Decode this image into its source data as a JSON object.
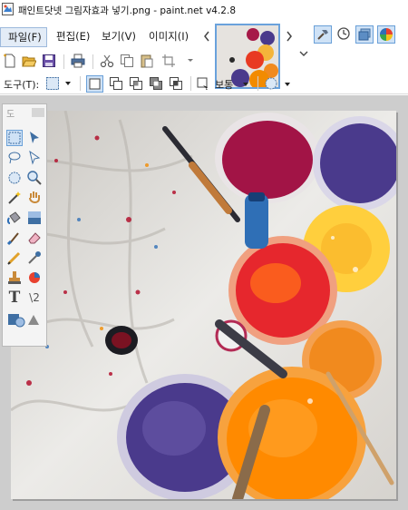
{
  "window": {
    "title": "패인트닷넷 그림자효과 넣기.png - paint.net v4.2.8"
  },
  "menu": {
    "items": [
      {
        "id": "file",
        "label": "파일(F)"
      },
      {
        "id": "edit",
        "label": "편집(E)"
      },
      {
        "id": "view",
        "label": "보기(V)"
      },
      {
        "id": "image",
        "label": "이미지(I)"
      }
    ]
  },
  "toolbar2": {
    "tool_label": "도구(T):",
    "sampling_label": "보통"
  },
  "tools_palette": {
    "title": "도"
  },
  "icons": {
    "app": "paintnet-app-icon",
    "nav_prev": "chevron-left-icon",
    "nav_next": "chevron-right-icon",
    "overflow": "chevron-down-icon",
    "tools_window": "hammer-icon",
    "history_window": "history-clock-icon",
    "layers_window": "layers-icon",
    "colors_window": "color-wheel-icon"
  },
  "colors": {
    "accent": "#6aa2dc",
    "selected_fill": "#cfe2f6",
    "workspace": "#cdcdcd",
    "paint_purple": "#4a3a8c",
    "paint_orange": "#ff8a00",
    "paint_red": "#e6272d",
    "paint_yellow": "#ffcf3d",
    "paint_magenta": "#b0123d",
    "paint_blue": "#2f6fb6"
  }
}
